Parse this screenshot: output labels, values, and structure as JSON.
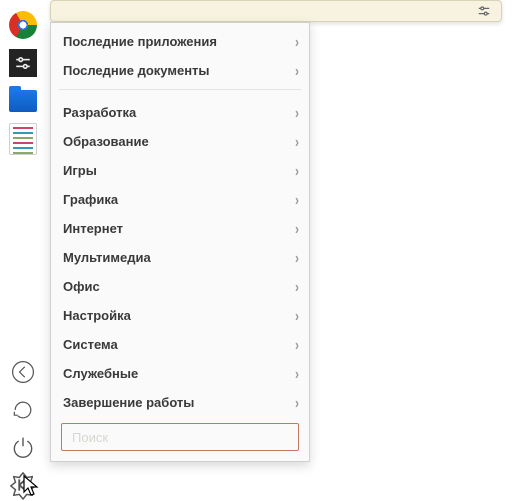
{
  "menu": {
    "top_items": [
      {
        "label": "Последние приложения"
      },
      {
        "label": "Последние документы"
      }
    ],
    "categories": [
      {
        "label": "Разработка"
      },
      {
        "label": "Образование"
      },
      {
        "label": "Игры"
      },
      {
        "label": "Графика"
      },
      {
        "label": "Интернет"
      },
      {
        "label": "Мультимедиа"
      },
      {
        "label": "Офис"
      },
      {
        "label": "Настройка"
      },
      {
        "label": "Система"
      },
      {
        "label": "Служебные"
      },
      {
        "label": "Завершение работы"
      }
    ],
    "search_placeholder": "Поиск"
  },
  "dock": {
    "items": [
      "chrome",
      "settings",
      "files",
      "text-editor"
    ],
    "system_icons": [
      "back",
      "refresh",
      "power"
    ],
    "menu_icon": "k-menu"
  }
}
